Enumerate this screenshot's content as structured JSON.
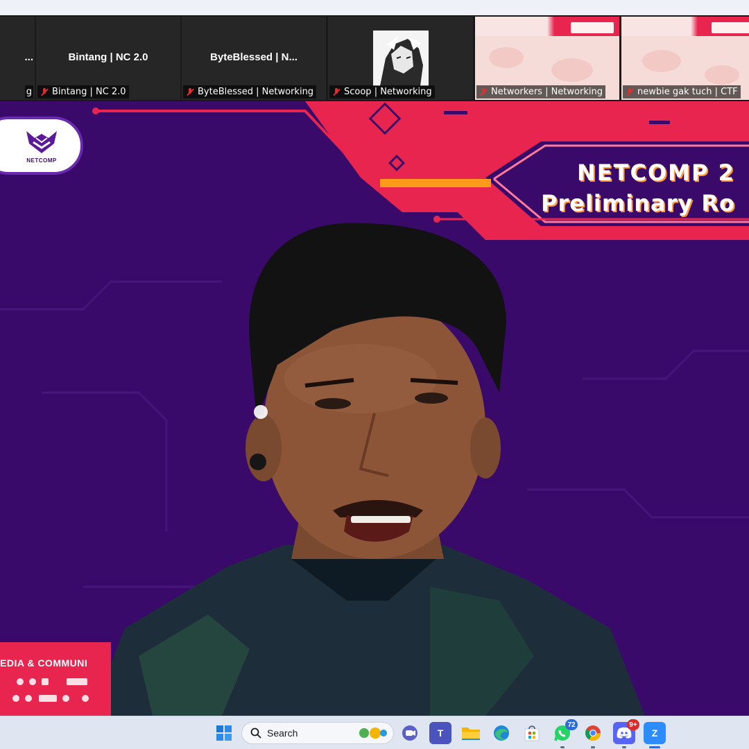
{
  "participants": [
    {
      "big_name": "...",
      "label": "g"
    },
    {
      "big_name": "Bintang | NC 2.0",
      "label": "Bintang | NC 2.0"
    },
    {
      "big_name": "ByteBlessed | N...",
      "label": "ByteBlessed | Networking"
    },
    {
      "big_name": "",
      "label": "Scoop | Networking"
    },
    {
      "big_name": "",
      "label": "Networkers | Networking"
    },
    {
      "big_name": "",
      "label": "newbie gak tuch | CTF"
    }
  ],
  "main_video": {
    "logo_text": "NETCOMP",
    "title_line_1": "NETCOMP 2",
    "title_line_2": "Preliminary Ro",
    "banner_text": "EDIA & COMMUNI"
  },
  "taskbar": {
    "search_label": "Search",
    "whatsapp_badge": "72",
    "discord_badge": "9+",
    "icons": [
      "windows-start-icon",
      "search-icon",
      "weather-icon",
      "chat-icon",
      "teams-icon",
      "file-explorer-icon",
      "edge-icon",
      "store-icon",
      "whatsapp-icon",
      "chrome-icon",
      "discord-icon",
      "zoom-icon"
    ]
  },
  "colors": {
    "video_bg": "#3a0a6a",
    "accent_pink": "#e8254f",
    "accent_orange": "#ff9a3a",
    "taskbar_bg": "#dfe6f1",
    "muted_mic": "#e02f2f"
  }
}
